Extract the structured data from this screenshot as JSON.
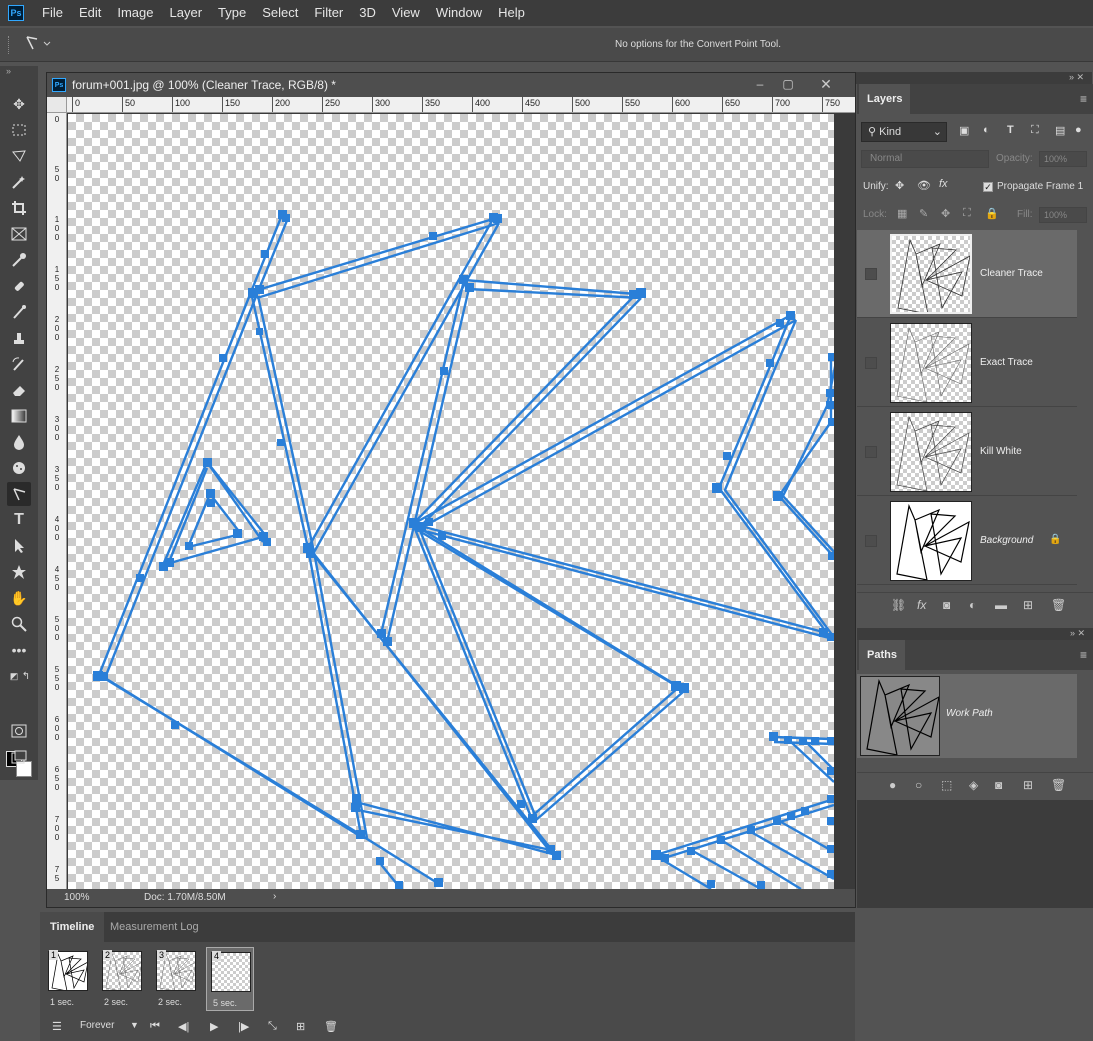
{
  "menu": [
    "File",
    "Edit",
    "Image",
    "Layer",
    "Type",
    "Select",
    "Filter",
    "3D",
    "View",
    "Window",
    "Help"
  ],
  "app_logo": "Ps",
  "options_bar": {
    "message": "No options for the Convert Point Tool."
  },
  "document": {
    "title": "forum+001.jpg @ 100% (Cleaner Trace, RGB/8) *",
    "zoom": "100%",
    "doc_size": "Doc: 1.70M/8.50M",
    "ruler_h": [
      "0",
      "50",
      "100",
      "150",
      "200",
      "250",
      "300",
      "350",
      "400",
      "450",
      "500",
      "550",
      "600",
      "650",
      "700",
      "750"
    ],
    "ruler_v": [
      "0",
      "5\n0",
      "1\n0\n0",
      "1\n5\n0",
      "2\n0\n0",
      "2\n5\n0",
      "3\n0\n0",
      "3\n5\n0",
      "4\n0\n0",
      "4\n5\n0",
      "5\n0\n0",
      "5\n5\n0",
      "6\n0\n0",
      "6\n5\n0",
      "7\n0\n0",
      "7\n5"
    ]
  },
  "layers_panel": {
    "tab": "Layers",
    "filter_kind": "Kind",
    "blend_mode": "Normal",
    "opacity_label": "Opacity:",
    "opacity_value": "100%",
    "unify_label": "Unify:",
    "propagate_label": "Propagate Frame 1",
    "lock_label": "Lock:",
    "fill_label": "Fill:",
    "fill_value": "100%",
    "layers": [
      {
        "name": "Cleaner Trace",
        "selected": true
      },
      {
        "name": "Exact Trace",
        "selected": false
      },
      {
        "name": "Kill White",
        "selected": false
      },
      {
        "name": "Background",
        "selected": false,
        "locked": true
      }
    ]
  },
  "paths_panel": {
    "tab": "Paths",
    "paths": [
      {
        "name": "Work Path"
      }
    ]
  },
  "timeline": {
    "tabs": [
      "Timeline",
      "Measurement Log"
    ],
    "frames": [
      {
        "num": "1",
        "delay": "1 sec."
      },
      {
        "num": "2",
        "delay": "2 sec."
      },
      {
        "num": "3",
        "delay": "2 sec."
      },
      {
        "num": "4",
        "delay": "5 sec."
      }
    ],
    "loop": "Forever"
  },
  "colors": {
    "path_blue": "#2a7fd8",
    "ps_blue": "#31a8ff"
  }
}
